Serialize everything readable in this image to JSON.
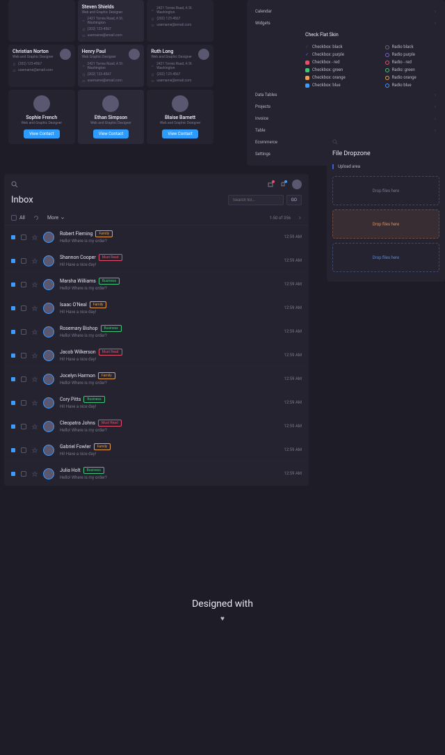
{
  "contacts": {
    "partial": [
      {
        "name": "Steven Shields",
        "role": "Web and Graphic Designer",
        "addr": "2421 Torres Road, A St. Washington",
        "phone": "(202) 123-4567",
        "email": "username@email.com"
      },
      {
        "addr": "2421 Torres Road, A St. Washington",
        "phone": "(202) 123-4567",
        "email": "username@email.com"
      }
    ],
    "full": [
      {
        "name": "Christian Norton",
        "role": "Web and Graphic Designer",
        "phone": "(202) 123-4567",
        "email": "username@email.com"
      },
      {
        "name": "Henry Paul",
        "role": "Web Graphic Designer",
        "addr": "2421 Torres Road, A St. Washington",
        "phone": "(202) 123-4567",
        "email": "username@email.com"
      },
      {
        "name": "Ruth Long",
        "role": "Web and Graphic Designer",
        "addr": "2421 Torres Road, A St. Washington",
        "phone": "(202) 123-4567",
        "email": "username@email.com"
      }
    ],
    "vertical": [
      {
        "name": "Sophie French",
        "role": "Web and Graphic Designer",
        "btn": "View Contact"
      },
      {
        "name": "Ethan Simpson",
        "role": "Web and Graphic Designer",
        "btn": "View Contact"
      },
      {
        "name": "Blaise Barnett",
        "role": "Web and Graphic Designer",
        "btn": "View Contact"
      }
    ]
  },
  "config": {
    "rows": [
      "Calendar",
      "Widgets",
      "Data Tables",
      "Projects",
      "Invoice",
      "Table",
      "Ecommerce",
      "Settings"
    ],
    "header": "Check Flat Skin",
    "checkboxes": [
      {
        "label": "Checkbox: black",
        "c": "#4a4858"
      },
      {
        "label": "Checkbox: purple",
        "c": "#7a5fd8"
      },
      {
        "label": "Checkbox - red",
        "c": "#e84f6a"
      },
      {
        "label": "Checkbox: green",
        "c": "#3ec97a"
      },
      {
        "label": "Checkbox: orange",
        "c": "#f0a045"
      },
      {
        "label": "Checkbox: blue",
        "c": "#3e9cff"
      }
    ],
    "radios": [
      {
        "label": "Radio black",
        "c": "#6a6880"
      },
      {
        "label": "Radio purple",
        "c": "#7a5fd8"
      },
      {
        "label": "Radio - red",
        "c": "#e84f6a"
      },
      {
        "label": "Radio: green",
        "c": "#3ec97a"
      },
      {
        "label": "Radio orange",
        "c": "#f0a045"
      },
      {
        "label": "Radio blue",
        "c": "#3e9cff"
      }
    ]
  },
  "dropzone": {
    "title": "File Dropzone",
    "label": "Upload area",
    "areas": [
      "Drop files here",
      "Drop files here",
      "Drop files here"
    ]
  },
  "inbox": {
    "title": "Inbox",
    "search_placeholder": "Search for...",
    "go": "GO",
    "all": "All",
    "more": "More",
    "pagination": "1-50 of 356",
    "rows": [
      {
        "name": "Robert Fleming",
        "tag": "Family",
        "tc": "#f0a045",
        "prev": "Hello! Where is my order?",
        "time": "12:59 AM"
      },
      {
        "name": "Shannon Cooper",
        "tag": "Must Read",
        "tc": "#e84f6a",
        "prev": "Hi! Have a nice day!",
        "time": "12:59 AM"
      },
      {
        "name": "Marsha Williams",
        "tag": "Business",
        "tc": "#3ec97a",
        "prev": "Hello! Where is my order?",
        "time": "12:59 AM"
      },
      {
        "name": "Isaac O'Neal",
        "tag": "Family",
        "tc": "#f0a045",
        "prev": "Hi! Have a nice day!",
        "time": "12:59 AM"
      },
      {
        "name": "Rosemary Bishop",
        "tag": "Business",
        "tc": "#3ec97a",
        "prev": "Hello! Where is my order?",
        "time": "12:59 AM"
      },
      {
        "name": "Jacob Wilkerson",
        "tag": "Must Read",
        "tc": "#e84f6a",
        "prev": "Hi! Have a nice day!",
        "time": "12:59 AM"
      },
      {
        "name": "Jocelyn Harmon",
        "tag": "Family",
        "tc": "#f0a045",
        "prev": "Hello! Where is my order?",
        "time": "12:59 AM"
      },
      {
        "name": "Cory Pitts",
        "tag": "Business",
        "tc": "#3ec97a",
        "prev": "Hi! Have a nice day!",
        "time": "12:59 AM"
      },
      {
        "name": "Cleopatra Johns",
        "tag": "Must Read",
        "tc": "#e84f6a",
        "prev": "Hello! Where is my order?",
        "time": "12:59 AM"
      },
      {
        "name": "Gabriel Fowler",
        "tag": "Family",
        "tc": "#f0a045",
        "prev": "Hi! Have a nice day!",
        "time": "12:59 AM"
      },
      {
        "name": "Julia Holt",
        "tag": "Business",
        "tc": "#3ec97a",
        "prev": "Hello! Where is my order?",
        "time": "12:59 AM"
      }
    ]
  },
  "footer": "Designed with"
}
